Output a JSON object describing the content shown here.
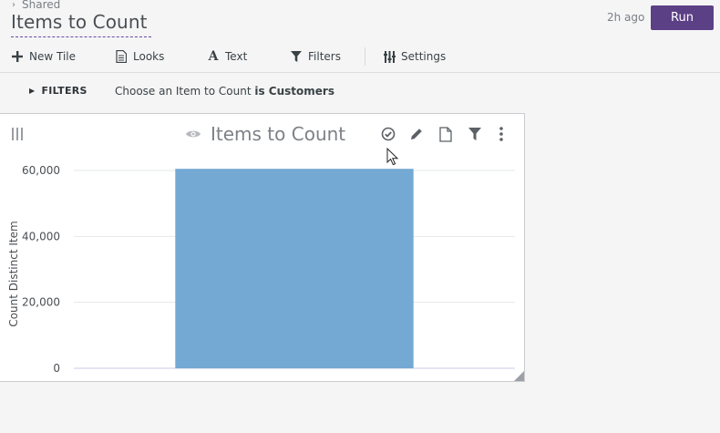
{
  "header": {
    "breadcrumb": "Shared",
    "title": "Items to Count",
    "last_run": "2h ago",
    "run_label": "Run"
  },
  "toolbar": {
    "new_tile": "New Tile",
    "looks": "Looks",
    "text": "Text",
    "filters": "Filters",
    "settings": "Settings"
  },
  "filters": {
    "toggle_label": "FILTERS",
    "summary_prefix": "Choose an Item to Count",
    "summary_bold": "is Customers"
  },
  "tile": {
    "title": "Items to Count"
  },
  "icons": {
    "breadcrumb": "chevron-right-icon",
    "new_tile": "plus-icon",
    "looks": "document-icon",
    "text": "text-icon",
    "filters": "funnel-icon",
    "settings": "sliders-icon",
    "drag": "drag-handle-icon",
    "eye": "eye-icon",
    "check": "check-circle-icon",
    "edit": "pencil-icon",
    "page": "page-icon",
    "tile_filter": "funnel-icon",
    "more": "more-vertical-icon"
  },
  "colors": {
    "accent": "#5c4086",
    "bar": "#73a9d3",
    "grid": "#e6e7ea",
    "axis_text": "#4a4f54"
  },
  "chart_data": {
    "type": "bar",
    "categories": [
      ""
    ],
    "values": [
      60500
    ],
    "title": "",
    "xlabel": "",
    "ylabel": "Count Distinct Item",
    "ylim": [
      0,
      60000
    ],
    "y_ticks": [
      0,
      20000,
      40000,
      60000
    ],
    "y_tick_labels": [
      "0",
      "20,000",
      "40,000",
      "60,000"
    ],
    "grid": true,
    "legend": "none"
  }
}
